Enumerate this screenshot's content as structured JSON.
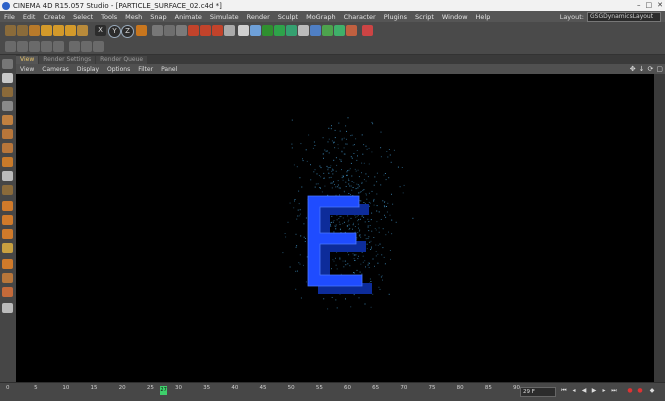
{
  "window": {
    "title": "CINEMA 4D R15.057 Studio - [PARTICLE_SURFACE_02.c4d *]",
    "controls": [
      "–",
      "□",
      "✕"
    ]
  },
  "menu": [
    "File",
    "Edit",
    "Create",
    "Select",
    "Tools",
    "Mesh",
    "Snap",
    "Animate",
    "Simulate",
    "Render",
    "Sculpt",
    "MoGraph",
    "Character",
    "Plugins",
    "Script",
    "Window",
    "Help"
  ],
  "layout": {
    "label": "Layout:",
    "value": "GSGDynamicsLayout"
  },
  "viewport_tabs": [
    "View",
    "Render Settings",
    "Render Queue"
  ],
  "viewport_menu": [
    "View",
    "Cameras",
    "Display",
    "Options",
    "Filter",
    "Panel"
  ],
  "toolbar_axis_labels": [
    "X",
    "Y",
    "Z"
  ],
  "timeline": {
    "ticks": [
      "0",
      "5",
      "10",
      "15",
      "20",
      "25",
      "30",
      "35",
      "40",
      "45",
      "50",
      "55",
      "60",
      "65",
      "70",
      "75",
      "80",
      "85",
      "90"
    ],
    "current_frame_marker": "27",
    "frame_field": "29 F",
    "playhead_fraction": 0.3
  },
  "scene": {
    "object": "E",
    "object_color": "#1f4cff",
    "particle_color": "#3c86b4"
  },
  "colors": {
    "accent_tab": "#e8c46a",
    "timeline_marker": "#3ed06b"
  }
}
